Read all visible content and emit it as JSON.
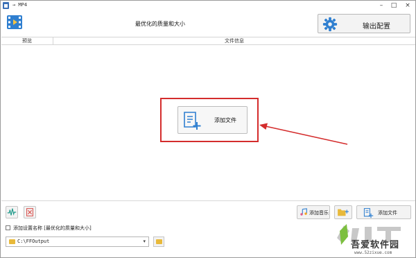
{
  "window": {
    "title": "→ MP4",
    "minimize": "–",
    "maximize": "□",
    "close": "×"
  },
  "header": {
    "profile_title": "最优化的质量和大小",
    "config_button_label": "输出配置"
  },
  "columns": {
    "preview": "预览",
    "file_info": "文件信息"
  },
  "center": {
    "add_file_label": "添加文件"
  },
  "toolbar": {
    "add_music_label": "添加音乐",
    "add_file_label": "添加文件"
  },
  "options": {
    "add_setting_name_label": "添加设置名称 [最优化的质量和大小]",
    "add_setting_name_checked": false
  },
  "output": {
    "path": "C:\\FFOutput",
    "dropdown_caret": "▾"
  },
  "watermark": {
    "brand": "吾爱软件园",
    "url": "www.52zixue.com"
  },
  "colors": {
    "accent_blue": "#2f7fd0",
    "highlight_red": "#d42c2c",
    "folder_yellow": "#e8b93a"
  },
  "icons": {
    "app": "app-icon",
    "video": "video-file-icon",
    "gear": "gear-icon",
    "add_document": "add-document-icon",
    "audio_wave": "audio-wave-icon",
    "delete": "delete-icon",
    "music": "music-note-icon",
    "folder_add": "folder-add-icon",
    "folder": "folder-icon"
  }
}
